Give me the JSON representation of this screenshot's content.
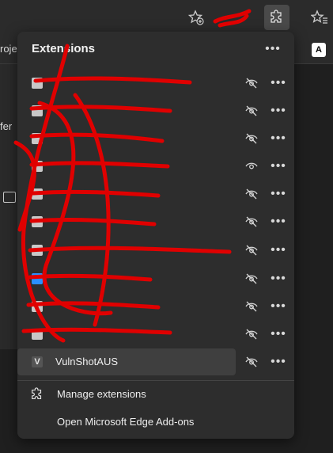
{
  "favorites": {
    "partial_label": "roje",
    "bookmark_icon": "A"
  },
  "behind": {
    "partial_text": "fer"
  },
  "panel": {
    "title": "Extensions",
    "items": [
      {
        "name": "",
        "icon_color": "#c8c8c8",
        "eye": "hidden"
      },
      {
        "name": "",
        "icon_color": "#c8c8c8",
        "eye": "hidden"
      },
      {
        "name": "",
        "icon_color": "#c8c8c8",
        "eye": "hidden"
      },
      {
        "name": "",
        "icon_color": "#c8c8c8",
        "eye": "visible"
      },
      {
        "name": "",
        "icon_color": "#c8c8c8",
        "eye": "hidden"
      },
      {
        "name": "",
        "icon_color": "#c8c8c8",
        "eye": "hidden"
      },
      {
        "name": "",
        "icon_color": "#c8c8c8",
        "eye": "hidden"
      },
      {
        "name": "",
        "icon_color": "#2a8fff",
        "eye": "hidden"
      },
      {
        "name": "",
        "icon_color": "#c8c8c8",
        "eye": "hidden"
      },
      {
        "name": "",
        "icon_color": "#c8c8c8",
        "eye": "hidden"
      },
      {
        "name": "VulnShotAUS",
        "icon_letter": "V",
        "icon_color": "#e6e6e6",
        "eye": "hidden"
      }
    ],
    "manage_label": "Manage extensions",
    "addons_label": "Open Microsoft Edge Add-ons"
  },
  "icons": {
    "favorite": "star-plus-icon",
    "extensions": "puzzle-icon",
    "favorites": "favorites-icon",
    "more": "more-dots-icon",
    "eye_hidden": "eye-slash-icon",
    "eye_visible": "eye-icon",
    "manage": "gear-icon"
  },
  "colors": {
    "panel_bg": "#2d2d2d",
    "hover_row": "#3f3f3f",
    "annotation_red": "#e00000"
  }
}
